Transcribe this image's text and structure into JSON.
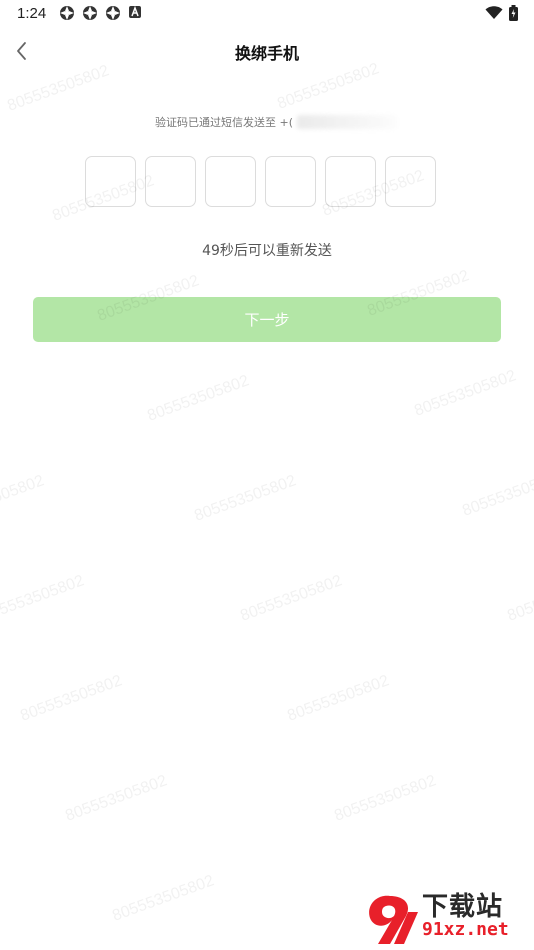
{
  "status_bar": {
    "time": "1:24"
  },
  "header": {
    "title": "换绑手机"
  },
  "verification": {
    "sent_prefix": "验证码已通过短信发送至 +(",
    "code_box_count": 6,
    "resend_text": "49秒后可以重新发送"
  },
  "actions": {
    "next_label": "下一步"
  },
  "watermark": {
    "text": "805553505802"
  },
  "logo": {
    "name": "下载站",
    "site": "91xz.net"
  },
  "colors": {
    "next_button_bg": "#b3e6a6",
    "box_border": "#dcdcdc"
  }
}
